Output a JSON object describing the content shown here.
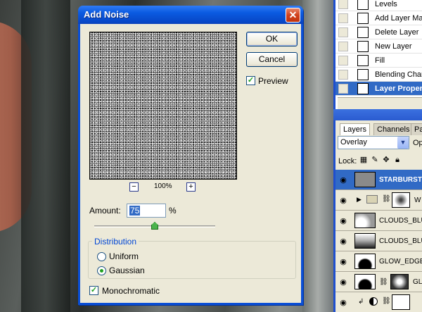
{
  "dialog": {
    "title": "Add Noise",
    "close_glyph": "✕",
    "ok_label": "OK",
    "cancel_label": "Cancel",
    "preview_label": "Preview",
    "preview_checked": true,
    "zoom_out": "−",
    "zoom_in": "+",
    "zoom_level": "100%",
    "amount_label": "Amount:",
    "amount_value": "75",
    "amount_unit": "%",
    "distribution_title": "Distribution",
    "uniform_label": "Uniform",
    "gaussian_label": "Gaussian",
    "selected_distribution": "Gaussian",
    "monochromatic_label": "Monochromatic",
    "monochromatic_checked": true
  },
  "history": {
    "items": [
      {
        "label": "Levels"
      },
      {
        "label": "Add Layer Mas"
      },
      {
        "label": "Delete Layer"
      },
      {
        "label": "New Layer"
      },
      {
        "label": "Fill"
      },
      {
        "label": "Blending Chan"
      },
      {
        "label": "Layer Proper"
      }
    ],
    "selected_index": 6
  },
  "layers_panel": {
    "tabs": [
      "Layers",
      "Channels",
      "Pa"
    ],
    "blend_mode": "Overlay",
    "opacity_label": "Op",
    "lock_label": "Lock:",
    "eye_glyph": "👁",
    "layers": [
      {
        "name": "STARBURST",
        "selected": true
      },
      {
        "name": "W",
        "selected": false
      },
      {
        "name": "CLOUDS_BLU",
        "selected": false
      },
      {
        "name": "CLOUDS_BLU",
        "selected": false
      },
      {
        "name": "GLOW_EDGES",
        "selected": false
      },
      {
        "name": "GL",
        "selected": false
      },
      {
        "name": "",
        "selected": false
      }
    ]
  },
  "colors": {
    "xp_title_blue": "#0a5ae0",
    "selection_blue": "#316ac5",
    "dialog_face": "#ece9d8",
    "group_title": "#0046d5"
  }
}
